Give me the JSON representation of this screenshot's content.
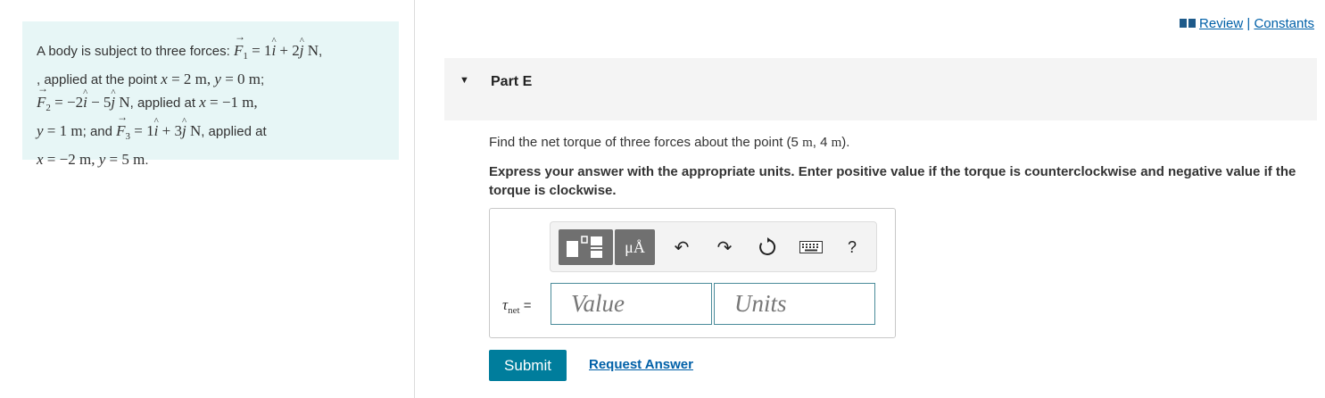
{
  "problem": {
    "t1": "A body is subject to three forces: ",
    "F": "F",
    "sub1": "1",
    "eq_F1_rhs_a": " = 1",
    "i": "i",
    "eq_F1_rhs_b": " + 2",
    "j": "j",
    "unitN": " N",
    "t2": ", applied at the point ",
    "x": "x",
    "y": "y",
    "eq_x1": " = 2 m, ",
    "eq_y1": " = 0 m",
    "t3": ";",
    "sub2": "2",
    "eq_F2_a": " = −2",
    "eq_F2_b": " − 5",
    "t4": ", applied at ",
    "eq_x2": " = −1 m,",
    "eq_y2": " = 1 m",
    "t5": "; and ",
    "sub3": "3",
    "eq_F3_a": " = 1",
    "eq_F3_b": " + 3",
    "t6": ", applied at",
    "eq_x3": " = −2 m, ",
    "eq_y3": " = 5 m",
    "t7": "."
  },
  "header": {
    "review": "Review",
    "separator": " | ",
    "constants": "Constants"
  },
  "part": {
    "title": "Part E",
    "caret": "▼"
  },
  "question": {
    "text_a": "Find the net torque of three forces about the point (5 ",
    "m": "m",
    "text_b": ", 4 ",
    "text_c": ")."
  },
  "instruction": "Express your answer with the appropriate units. Enter positive value if the torque is counterclockwise and negative value if the torque is clockwise.",
  "toolbar": {
    "units_glyph": "μÅ",
    "undo_glyph": "↶",
    "redo_glyph": "↷",
    "help_glyph": "?"
  },
  "answer": {
    "tau": "τ",
    "tau_sub": "net",
    "equals": " =",
    "value_placeholder": "Value",
    "units_placeholder": "Units"
  },
  "buttons": {
    "submit": "Submit",
    "request_answer": "Request Answer"
  },
  "colors": {
    "problem_bg": "#e7f6f6",
    "accent": "#007d9c",
    "link": "#0060a8"
  }
}
